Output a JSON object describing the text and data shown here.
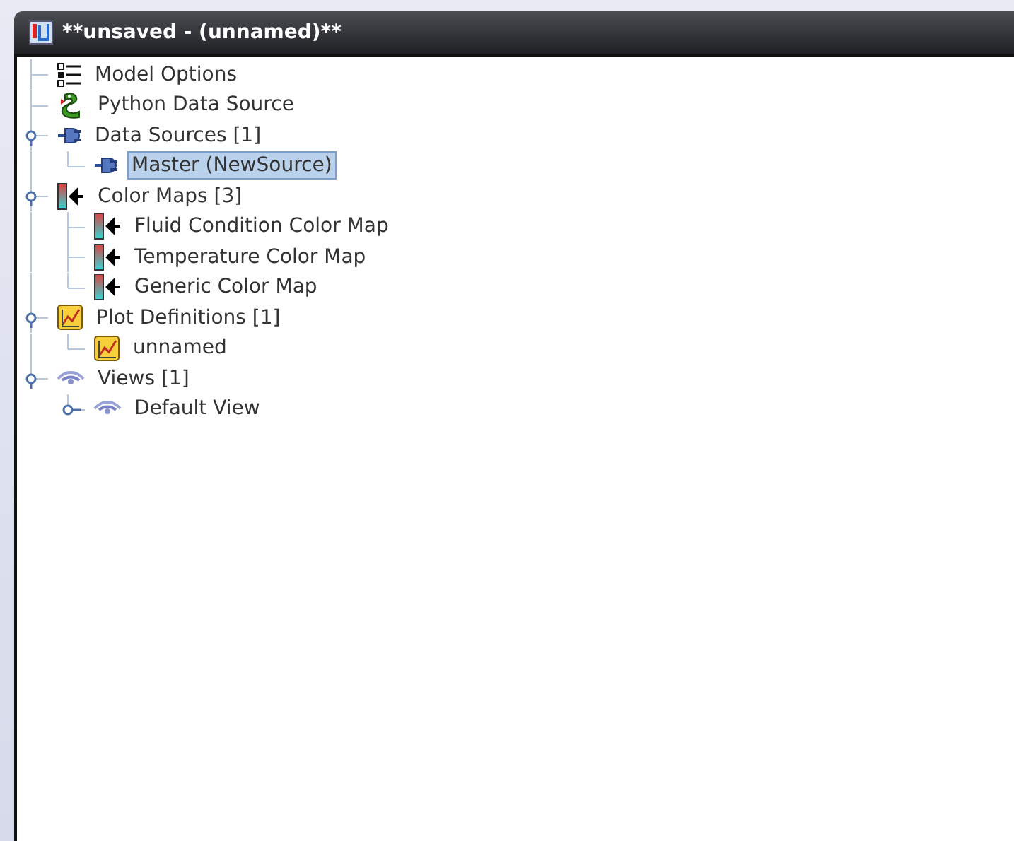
{
  "window": {
    "title": "**unsaved - (unnamed)**"
  },
  "tree": [
    {
      "label": "Model Options",
      "kind": "list",
      "selected": false
    },
    {
      "label": "Python Data Source",
      "kind": "python",
      "selected": false
    },
    {
      "label": "Data Sources [1]",
      "kind": "plug",
      "selected": false,
      "expanded": true,
      "children": [
        {
          "label": "Master (NewSource)",
          "kind": "plug",
          "selected": true
        }
      ]
    },
    {
      "label": "Color Maps [3]",
      "kind": "colormap",
      "selected": false,
      "expanded": true,
      "children": [
        {
          "label": "Fluid Condition Color Map",
          "kind": "colormap",
          "selected": false
        },
        {
          "label": "Temperature Color Map",
          "kind": "colormap",
          "selected": false
        },
        {
          "label": "Generic Color Map",
          "kind": "colormap",
          "selected": false
        }
      ]
    },
    {
      "label": "Plot Definitions [1]",
      "kind": "plot",
      "selected": false,
      "expanded": true,
      "children": [
        {
          "label": "unnamed",
          "kind": "plot",
          "selected": false
        }
      ]
    },
    {
      "label": "Views [1]",
      "kind": "eye",
      "selected": false,
      "expanded": true,
      "children": [
        {
          "label": "Default View",
          "kind": "eye",
          "selected": false,
          "expanded": false
        }
      ]
    }
  ]
}
